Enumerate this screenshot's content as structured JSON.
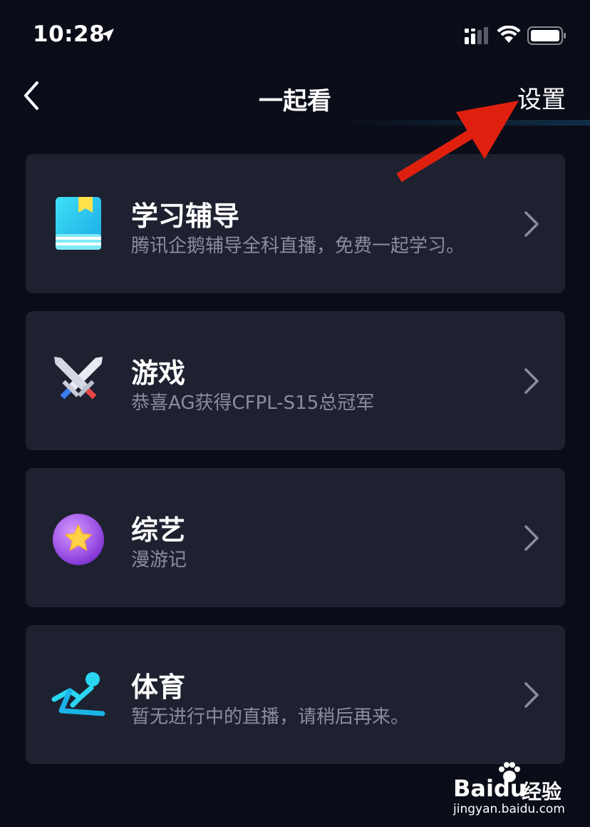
{
  "status_bar": {
    "time": "10:28",
    "icons": [
      "location-arrow-icon",
      "signal-icon",
      "wifi-icon",
      "battery-icon"
    ]
  },
  "nav": {
    "back_icon": "chevron-left-icon",
    "title": "一起看",
    "settings_label": "设置"
  },
  "cards": [
    {
      "icon": "book-icon",
      "title": "学习辅导",
      "subtitle": "腾讯企鹅辅导全科直播，免费一起学习。"
    },
    {
      "icon": "crossed-swords-icon",
      "title": "游戏",
      "subtitle": "恭喜AG获得CFPL-S15总冠军"
    },
    {
      "icon": "star-orb-icon",
      "title": "综艺",
      "subtitle": "漫游记"
    },
    {
      "icon": "runner-icon",
      "title": "体育",
      "subtitle": "暂无进行中的直播，请稍后再来。"
    }
  ],
  "annotation": {
    "color": "#e0200f"
  },
  "watermark": {
    "logo": "Bai",
    "logo_du": "du",
    "brand": "经验",
    "url": "jingyan.baidu.com"
  },
  "colors": {
    "background": "#0a0d18",
    "card": "#1e2130",
    "subtitle": "#8a8e9c"
  }
}
